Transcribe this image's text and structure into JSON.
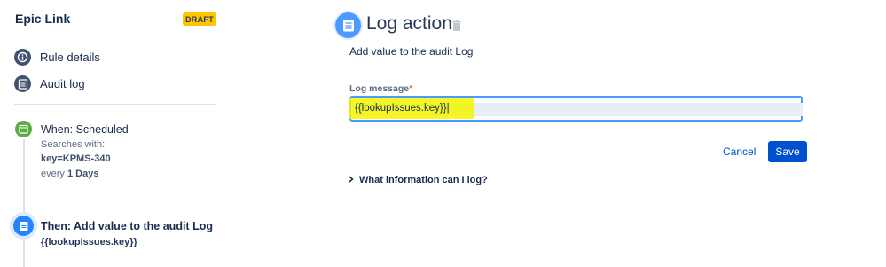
{
  "sidebar": {
    "rule_name": "Epic Link",
    "badge": "DRAFT",
    "items": [
      {
        "label": "Rule details",
        "icon": "info-icon"
      },
      {
        "label": "Audit log",
        "icon": "audit-log-icon"
      }
    ],
    "trigger": {
      "title": "When: Scheduled",
      "line1": "Searches with:",
      "line2": "key=KPMS-340",
      "line3_prefix": "every",
      "line3_value": "1 Days",
      "icon": "calendar-icon",
      "color": "#5aac44"
    },
    "action": {
      "title": "Then: Add value to the audit Log",
      "value": "{{lookupIssues.key}}",
      "icon": "log-icon",
      "color": "#2684ff"
    }
  },
  "main": {
    "title": "Log action",
    "description": "Add value to the audit Log",
    "field_label": "Log message",
    "required_marker": "*",
    "field_value": "{{lookupIssues.key}}|",
    "cancel_label": "Cancel",
    "save_label": "Save",
    "info_toggle": "What information can I log?",
    "icons": [
      "log-icon",
      "trash-icon",
      "chevron-right-icon"
    ],
    "accent": "#0052cc"
  }
}
